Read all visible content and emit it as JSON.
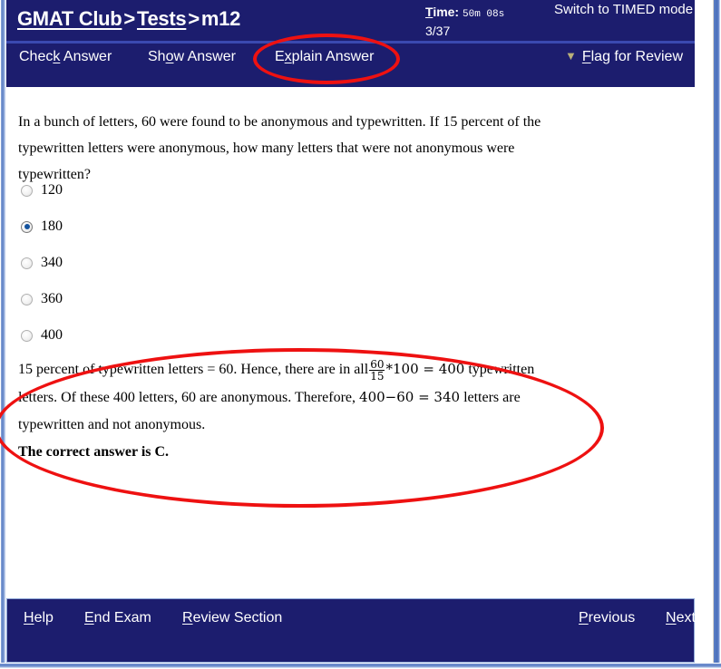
{
  "header": {
    "breadcrumb": {
      "site": "GMAT Club",
      "separator1": ">",
      "section": "Tests",
      "separator2": ">",
      "current": "m12"
    },
    "timer": {
      "label_accel": "T",
      "label_rest": "ime:",
      "value": "50m 08s",
      "progress": "3/37"
    },
    "switch_mode": "Switch to TIMED mode",
    "toolbar": {
      "check_answer": {
        "pre": "Chec",
        "accel": "k",
        "post": " Answer"
      },
      "show_answer": {
        "pre": "Sh",
        "accel": "o",
        "post": "w Answer"
      },
      "explain_answer": {
        "pre": "E",
        "accel": "x",
        "post": "plain Answer"
      },
      "flag_for_review": {
        "icon": "flag-icon",
        "pre": "",
        "accel": "F",
        "post": "lag for Review"
      }
    }
  },
  "question": {
    "text": "In a bunch of letters, 60 were found to be anonymous and typewritten. If 15 percent of the typewritten letters were anonymous, how many letters that were not anonymous were typewritten?",
    "choices": [
      {
        "label": "120",
        "selected": false
      },
      {
        "label": "180",
        "selected": true
      },
      {
        "label": "340",
        "selected": false
      },
      {
        "label": "360",
        "selected": false
      },
      {
        "label": "400",
        "selected": false
      }
    ]
  },
  "explanation": {
    "part1": "15 percent of typewritten letters = 60. Hence, there are in all",
    "fraction_numerator": "60",
    "fraction_denominator": "15",
    "math1": "*100 = 400",
    "part2": "typewritten letters. Of these 400 letters, 60 are anonymous. Therefore,",
    "math2": "400−60 = 340",
    "part3": "letters are typewritten and not anonymous.",
    "correct_answer": "The correct answer is C."
  },
  "footer": {
    "help": {
      "accel": "H",
      "post": "elp"
    },
    "end_exam": {
      "accel": "E",
      "post": "nd Exam"
    },
    "review_section": {
      "accel": "R",
      "post": "eview Section"
    },
    "previous": {
      "accel": "P",
      "post": "revious"
    },
    "next": {
      "accel": "N",
      "post": "ext"
    }
  },
  "annotations": {
    "color": "#ee1111",
    "ellipse_explain_answer": "highlight around Explain Answer toolbar link",
    "ellipse_explanation_body": "highlight around explanation body text"
  },
  "colors": {
    "header_bg": "#1c1d6e",
    "divider": "#3a49b0",
    "content_bg": "#ffffff",
    "radio_selected": "#15539e",
    "annotation_red": "#ee1111"
  }
}
